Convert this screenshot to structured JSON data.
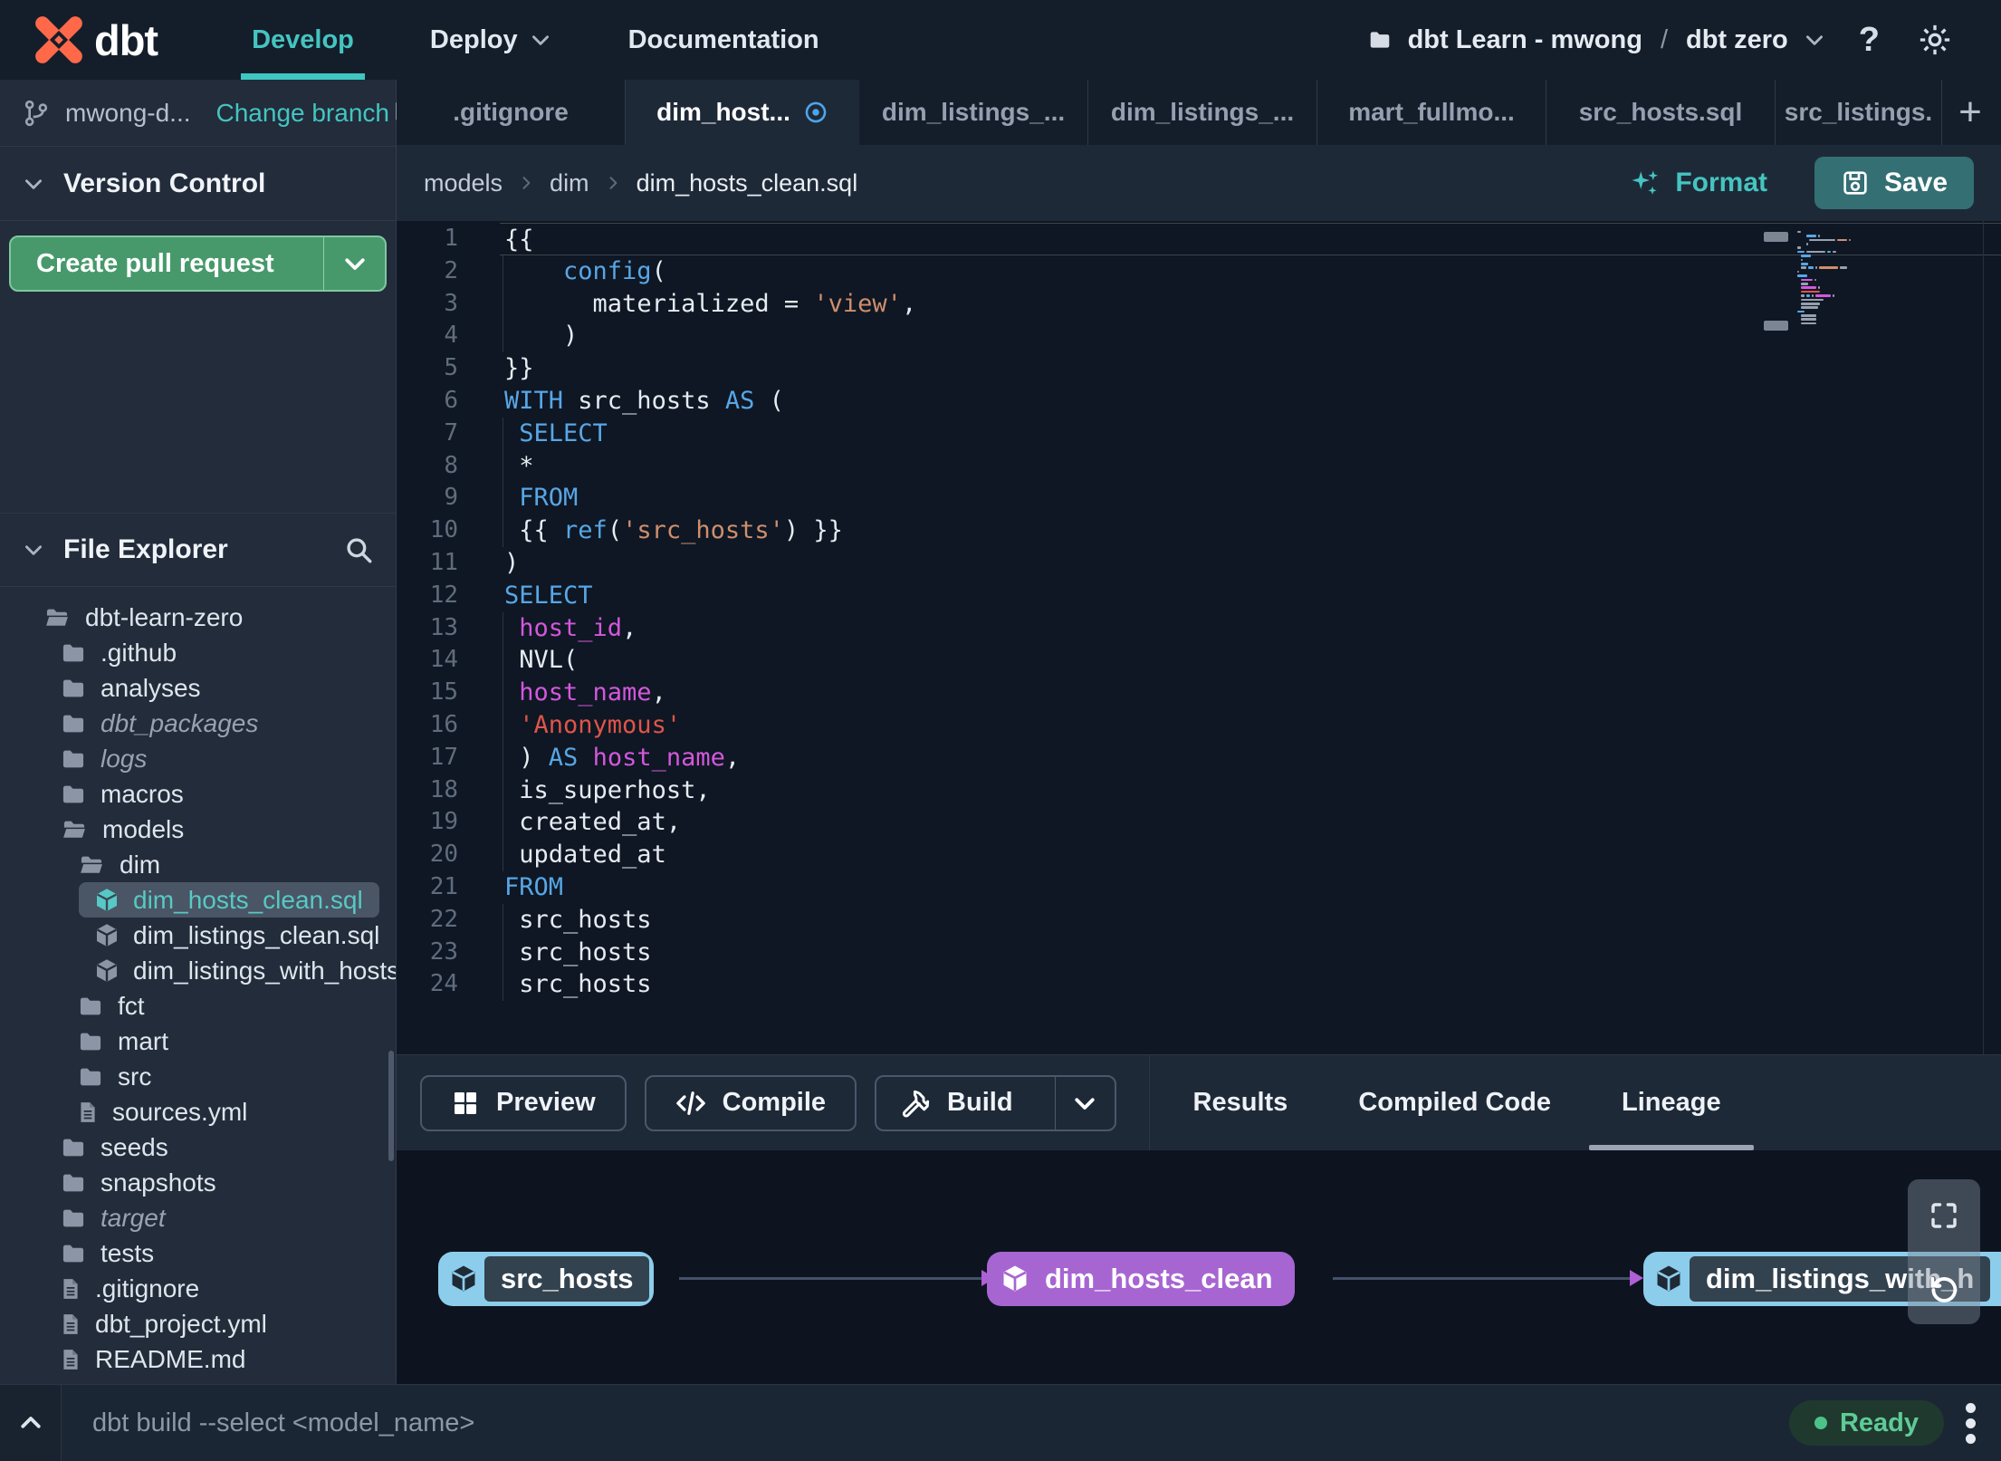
{
  "navbar": {
    "brand": "dbt",
    "items": [
      {
        "label": "Develop",
        "active": true,
        "caret": false
      },
      {
        "label": "Deploy",
        "active": false,
        "caret": true
      },
      {
        "label": "Documentation",
        "active": false,
        "caret": false
      }
    ],
    "project": "dbt Learn - mwong",
    "separator": "/",
    "environment": "dbt zero",
    "help_label": "?"
  },
  "sidebar": {
    "branch": {
      "name": "mwong-d...",
      "change_link": "Change branch"
    },
    "version_control": {
      "title": "Version Control",
      "cta": "Create pull request"
    },
    "file_explorer": {
      "title": "File Explorer",
      "tree": [
        {
          "name": "dbt-learn-zero",
          "depth": 0,
          "icon": "folder-open"
        },
        {
          "name": ".github",
          "depth": 1,
          "icon": "folder"
        },
        {
          "name": "analyses",
          "depth": 1,
          "icon": "folder"
        },
        {
          "name": "dbt_packages",
          "depth": 1,
          "icon": "folder",
          "italic": true
        },
        {
          "name": "logs",
          "depth": 1,
          "icon": "folder",
          "italic": true
        },
        {
          "name": "macros",
          "depth": 1,
          "icon": "folder"
        },
        {
          "name": "models",
          "depth": 1,
          "icon": "folder-open"
        },
        {
          "name": "dim",
          "depth": 2,
          "icon": "folder-open"
        },
        {
          "name": "dim_hosts_clean.sql",
          "depth": 3,
          "icon": "model",
          "selected": true,
          "modified": true
        },
        {
          "name": "dim_listings_clean.sql",
          "depth": 3,
          "icon": "model"
        },
        {
          "name": "dim_listings_with_hosts...",
          "depth": 3,
          "icon": "model"
        },
        {
          "name": "fct",
          "depth": 2,
          "icon": "folder"
        },
        {
          "name": "mart",
          "depth": 2,
          "icon": "folder"
        },
        {
          "name": "src",
          "depth": 2,
          "icon": "folder"
        },
        {
          "name": "sources.yml",
          "depth": 2,
          "icon": "file"
        },
        {
          "name": "seeds",
          "depth": 1,
          "icon": "folder"
        },
        {
          "name": "snapshots",
          "depth": 1,
          "icon": "folder"
        },
        {
          "name": "target",
          "depth": 1,
          "icon": "folder",
          "italic": true
        },
        {
          "name": "tests",
          "depth": 1,
          "icon": "folder"
        },
        {
          "name": ".gitignore",
          "depth": 1,
          "icon": "file"
        },
        {
          "name": "dbt_project.yml",
          "depth": 1,
          "icon": "file"
        },
        {
          "name": "README.md",
          "depth": 1,
          "icon": "file"
        }
      ]
    }
  },
  "tabs": [
    {
      "label": ".gitignore"
    },
    {
      "label": "dim_host...",
      "active": true,
      "modified": true
    },
    {
      "label": "dim_listings_..."
    },
    {
      "label": "dim_listings_..."
    },
    {
      "label": "mart_fullmo..."
    },
    {
      "label": "src_hosts.sql"
    },
    {
      "label": "src_listings.",
      "narrow": true
    }
  ],
  "editor": {
    "breadcrumb": [
      "models",
      "dim",
      "dim_hosts_clean.sql"
    ],
    "format_label": "Format",
    "save_label": "Save",
    "active_line": 1,
    "lines": [
      [
        [
          "{{",
          "def"
        ]
      ],
      [
        [
          "    ",
          ""
        ],
        [
          "config",
          "kw"
        ],
        [
          "(",
          "def"
        ]
      ],
      [
        [
          "      ",
          ""
        ],
        [
          "materialized = ",
          "def"
        ],
        [
          "'view'",
          "str"
        ],
        [
          ",",
          "def"
        ]
      ],
      [
        [
          "    ",
          ""
        ],
        [
          ")",
          "def"
        ]
      ],
      [
        [
          "}}",
          "def"
        ]
      ],
      [
        [
          "WITH",
          "kw"
        ],
        [
          " src_hosts ",
          "def"
        ],
        [
          "AS",
          "kw"
        ],
        [
          " (",
          "def"
        ]
      ],
      [
        [
          " ",
          ""
        ],
        [
          "SELECT",
          "kw"
        ]
      ],
      [
        [
          " ",
          ""
        ],
        [
          "*",
          "def"
        ]
      ],
      [
        [
          " ",
          ""
        ],
        [
          "FROM",
          "kw"
        ]
      ],
      [
        [
          " ",
          ""
        ],
        [
          "{{ ",
          "def"
        ],
        [
          "ref",
          "kw"
        ],
        [
          "(",
          "def"
        ],
        [
          "'src_hosts'",
          "str"
        ],
        [
          ") }}",
          "def"
        ]
      ],
      [
        [
          ")",
          "def"
        ]
      ],
      [
        [
          "SELECT",
          "kw"
        ]
      ],
      [
        [
          " ",
          ""
        ],
        [
          "host_id",
          "var"
        ],
        [
          ",",
          "def"
        ]
      ],
      [
        [
          " ",
          ""
        ],
        [
          "NVL(",
          "def"
        ]
      ],
      [
        [
          " ",
          ""
        ],
        [
          "host_name",
          "var"
        ],
        [
          ",",
          "def"
        ]
      ],
      [
        [
          " ",
          ""
        ],
        [
          "'Anonymous'",
          "str2"
        ]
      ],
      [
        [
          " ",
          ""
        ],
        [
          ") ",
          "def"
        ],
        [
          "AS",
          "kw"
        ],
        [
          " ",
          "def"
        ],
        [
          "host_name",
          "var"
        ],
        [
          ",",
          "def"
        ]
      ],
      [
        [
          " ",
          ""
        ],
        [
          "is_superhost,",
          "def"
        ]
      ],
      [
        [
          " ",
          ""
        ],
        [
          "created_at,",
          "def"
        ]
      ],
      [
        [
          " ",
          ""
        ],
        [
          "updated_at",
          "def"
        ]
      ],
      [
        [
          "FROM",
          "kw"
        ]
      ],
      [
        [
          " ",
          ""
        ],
        [
          "src_hosts",
          "def"
        ]
      ],
      [
        [
          " ",
          ""
        ],
        [
          "src_hosts",
          "def"
        ]
      ],
      [
        [
          " ",
          ""
        ],
        [
          "src_hosts",
          "def"
        ]
      ]
    ]
  },
  "invoke": {
    "preview_label": "Preview",
    "compile_label": "Compile",
    "build_label": "Build",
    "tabs": [
      {
        "label": "Results"
      },
      {
        "label": "Compiled Code"
      },
      {
        "label": "Lineage",
        "active": true
      }
    ]
  },
  "lineage": {
    "nodes": [
      {
        "label": "src_hosts",
        "style": "source-blue"
      },
      {
        "label": "dim_hosts_clean",
        "style": "model-purple"
      },
      {
        "label": "dim_listings_with_h",
        "style": "source-blue"
      }
    ]
  },
  "statusbar": {
    "command": "dbt build --select <model_name>",
    "status": "Ready"
  },
  "colors": {
    "accent_teal": "#45c4c0",
    "brand_orange": "#ff694a",
    "pr_green": "#47996b",
    "save_teal": "#336f73",
    "node_blue": "#8ccdeb",
    "node_purple": "#a765d2",
    "ready_green": "#5ecb96",
    "syntax_keyword": "#58a6e6",
    "syntax_string": "#cf8e6d",
    "syntax_string_red": "#e0544a",
    "syntax_variable": "#d457dd"
  }
}
